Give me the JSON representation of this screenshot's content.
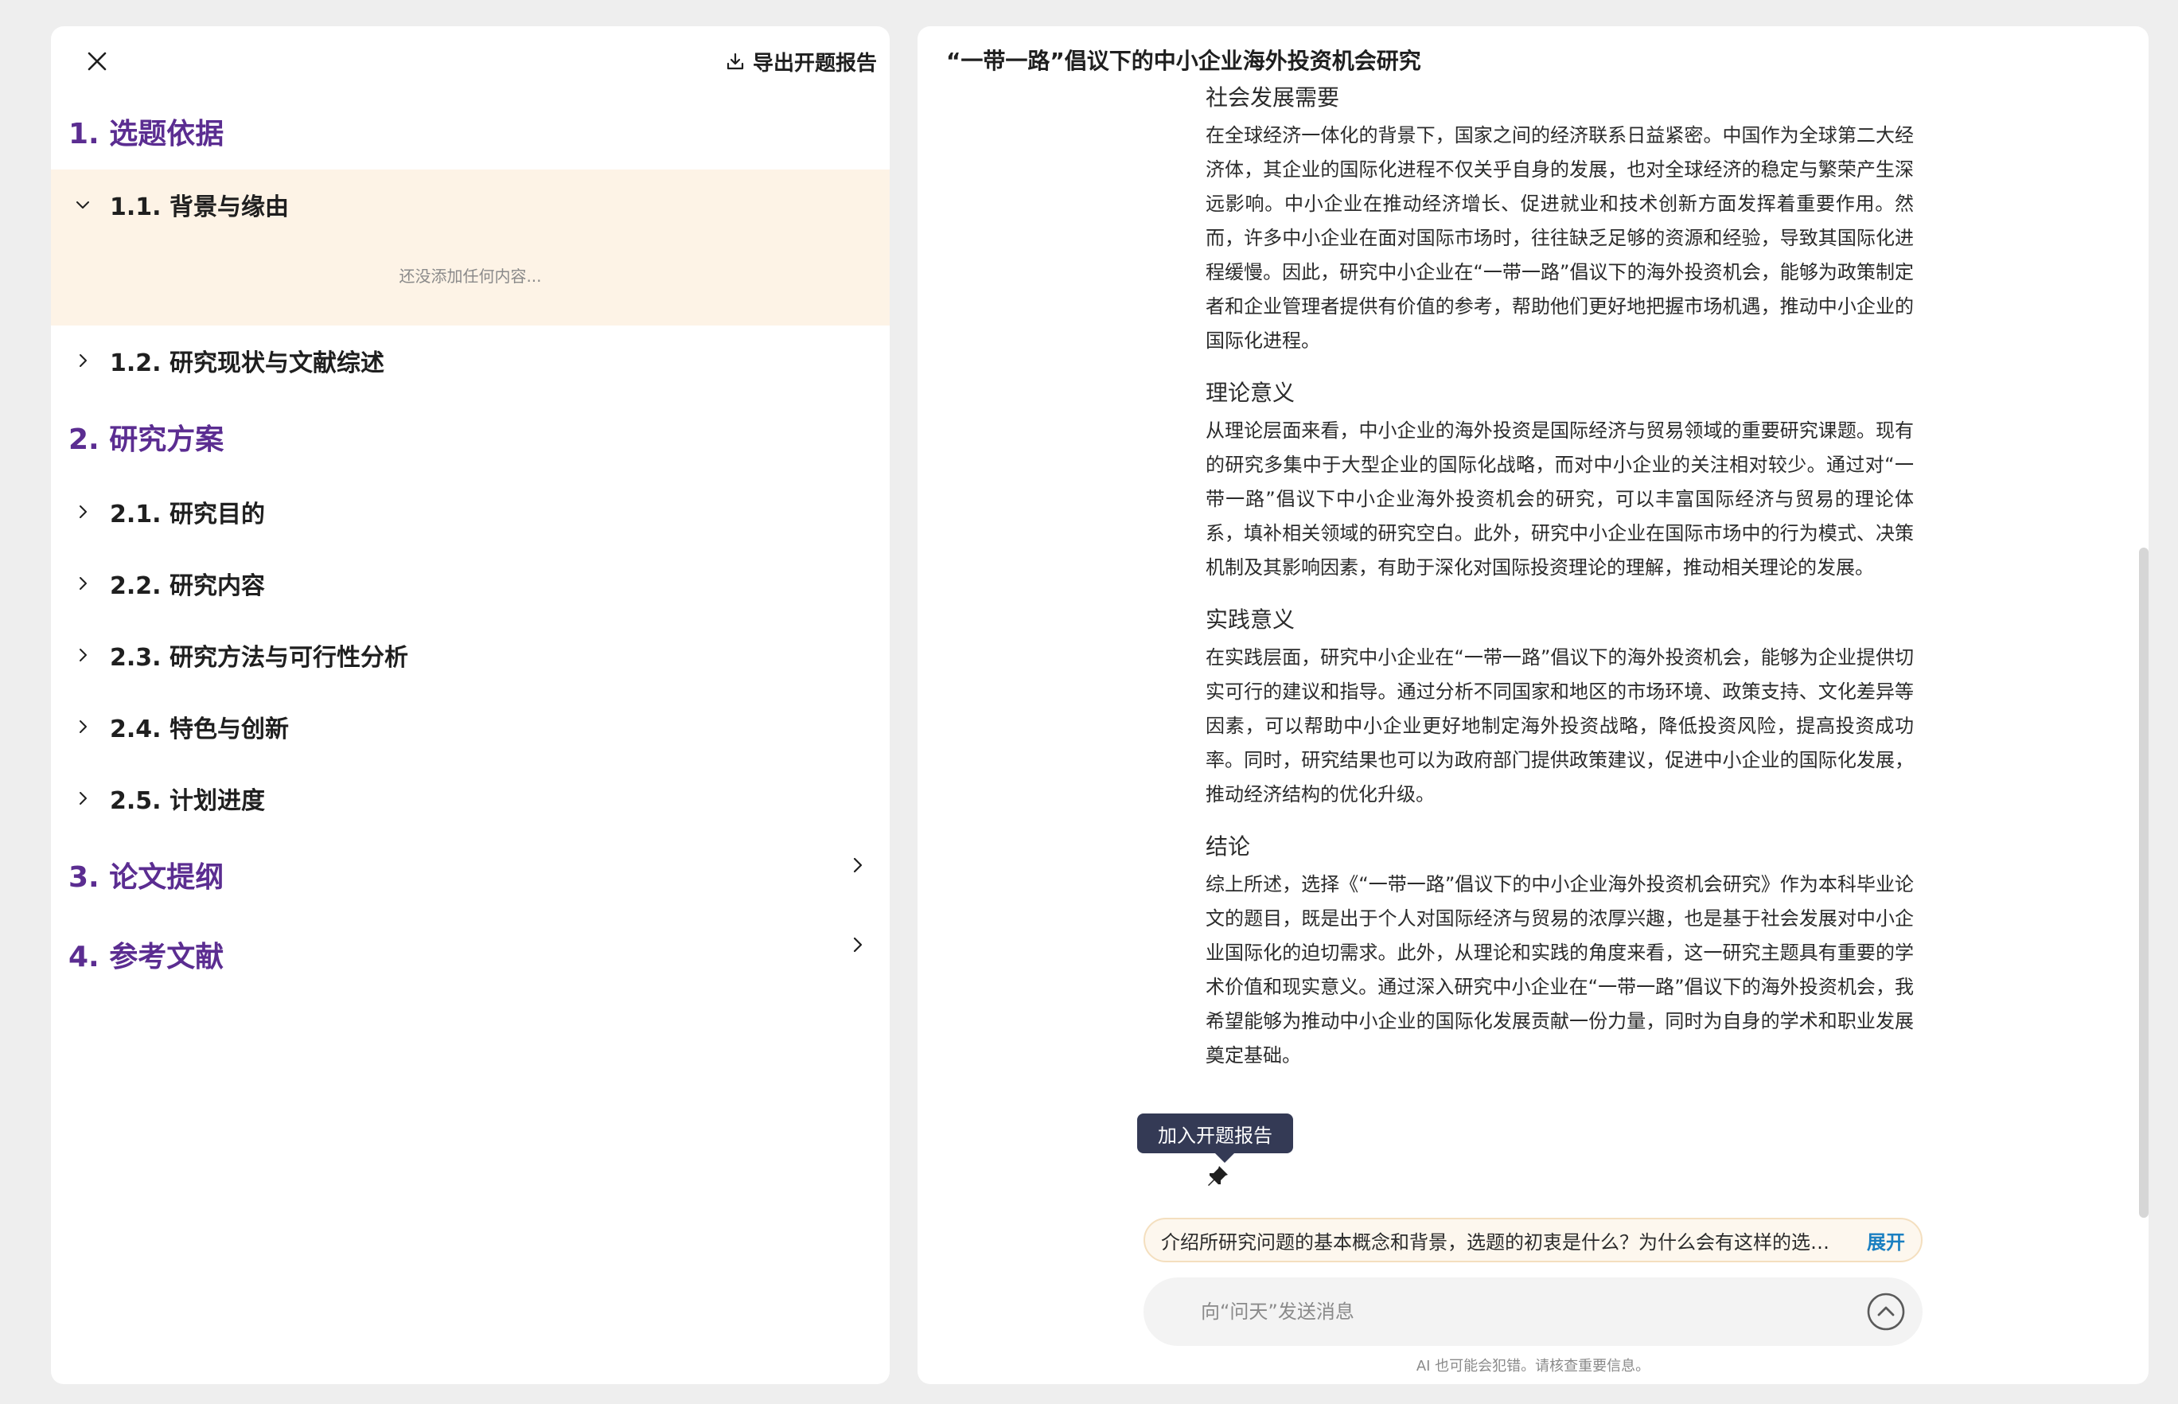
{
  "left": {
    "export_label": "导出开题报告",
    "sections": [
      {
        "title": "1. 选题依据"
      },
      {
        "title": "2. 研究方案"
      },
      {
        "title": "3. 论文提纲"
      },
      {
        "title": "4. 参考文献"
      }
    ],
    "items": [
      {
        "label": "1.1. 背景与缘由",
        "expanded": true
      },
      {
        "label": "1.2. 研究现状与文献综述"
      },
      {
        "label": "2.1. 研究目的"
      },
      {
        "label": "2.2. 研究内容"
      },
      {
        "label": "2.3. 研究方法与可行性分析"
      },
      {
        "label": "2.4. 特色与创新"
      },
      {
        "label": "2.5. 计划进度"
      }
    ],
    "empty_hint": "还没添加任何内容..."
  },
  "doc": {
    "title": "“一带一路”倡议下的中小企业海外投资机会研究",
    "blocks": [
      {
        "heading": "社会发展需要",
        "text": "在全球经济一体化的背景下，国家之间的经济联系日益紧密。中国作为全球第二大经济体，其企业的国际化进程不仅关乎自身的发展，也对全球经济的稳定与繁荣产生深远影响。中小企业在推动经济增长、促进就业和技术创新方面发挥着重要作用。然而，许多中小企业在面对国际市场时，往往缺乏足够的资源和经验，导致其国际化进程缓慢。因此，研究中小企业在“一带一路”倡议下的海外投资机会，能够为政策制定者和企业管理者提供有价值的参考，帮助他们更好地把握市场机遇，推动中小企业的国际化进程。"
      },
      {
        "heading": "理论意义",
        "text": "从理论层面来看，中小企业的海外投资是国际经济与贸易领域的重要研究课题。现有的研究多集中于大型企业的国际化战略，而对中小企业的关注相对较少。通过对“一带一路”倡议下中小企业海外投资机会的研究，可以丰富国际经济与贸易的理论体系，填补相关领域的研究空白。此外，研究中小企业在国际市场中的行为模式、决策机制及其影响因素，有助于深化对国际投资理论的理解，推动相关理论的发展。"
      },
      {
        "heading": "实践意义",
        "text": "在实践层面，研究中小企业在“一带一路”倡议下的海外投资机会，能够为企业提供切实可行的建议和指导。通过分析不同国家和地区的市场环境、政策支持、文化差异等因素，可以帮助中小企业更好地制定海外投资战略，降低投资风险，提高投资成功率。同时，研究结果也可以为政府部门提供政策建议，促进中小企业的国际化发展，推动经济结构的优化升级。"
      },
      {
        "heading": "结论",
        "text": "综上所述，选择《“一带一路”倡议下的中小企业海外投资机会研究》作为本科毕业论文的题目，既是出于个人对国际经济与贸易的浓厚兴趣，也是基于社会发展对中小企业国际化的迫切需求。此外，从理论和实践的角度来看，这一研究主题具有重要的学术价值和现实意义。通过深入研究中小企业在“一带一路”倡议下的海外投资机会，我希望能够为推动中小企业的国际化发展贡献一份力量，同时为自身的学术和职业发展奠定基础。"
      }
    ]
  },
  "tooltip": "加入开题报告",
  "prompt": {
    "text": "介绍所研究问题的基本概念和背景，选题的初衷是什么？为什么会有这样的选题？",
    "expand_label": "展开"
  },
  "chat": {
    "placeholder": "向“问天”发送消息"
  },
  "disclaimer": "AI 也可能会犯错。请核查重要信息。",
  "colors": {
    "accent_purple": "#5b2d91",
    "expanded_bg": "#fdf3e6",
    "link_blue": "#1a7fc1",
    "tooltip_bg": "#343a55"
  }
}
